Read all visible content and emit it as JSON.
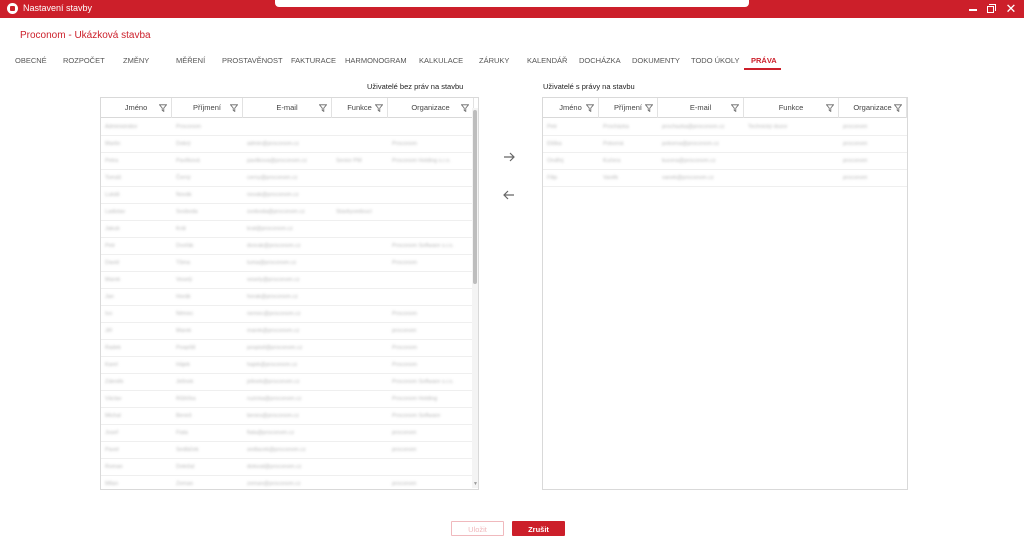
{
  "window": {
    "title": "Nastavení stavby"
  },
  "project": {
    "title": "Proconom - Ukázková stavba"
  },
  "tabs": [
    {
      "label": "OBECNÉ"
    },
    {
      "label": "ROZPOČET"
    },
    {
      "label": "ZMĚNY"
    },
    {
      "label": "MĚŘENÍ"
    },
    {
      "label": "PROSTAVĚNOST"
    },
    {
      "label": "FAKTURACE"
    },
    {
      "label": "HARMONOGRAM"
    },
    {
      "label": "KALKULACE"
    },
    {
      "label": "ZÁRUKY"
    },
    {
      "label": "KALENDÁŘ"
    },
    {
      "label": "DOCHÁZKA"
    },
    {
      "label": "DOKUMENTY"
    },
    {
      "label": "TODO ÚKOLY"
    },
    {
      "label": "PRÁVA"
    }
  ],
  "active_tab": "PRÁVA",
  "left_panel": {
    "label": "Uživatelé bez práv na stavbu",
    "columns": [
      "Jméno",
      "Příjmení",
      "E-mail",
      "Funkce",
      "Organizace"
    ],
    "rows": [
      [
        "Administrátor",
        "Proconom",
        "",
        "",
        ""
      ],
      [
        "Martin",
        "Dobrý",
        "admin@proconom.cz",
        "",
        "Proconom"
      ],
      [
        "Petra",
        "Pavlíková",
        "pavlikova@proconom.cz",
        "Senior PM",
        "Proconom Holding s.r.o."
      ],
      [
        "Tomáš",
        "Černý",
        "cerny@proconom.cz",
        "",
        ""
      ],
      [
        "Lukáš",
        "Novák",
        "novak@proconom.cz",
        "",
        ""
      ],
      [
        "Ladislav",
        "Svoboda",
        "svoboda@proconom.cz",
        "Stavbyvedoucí",
        ""
      ],
      [
        "Jakub",
        "Král",
        "kral@proconom.cz",
        "",
        ""
      ],
      [
        "Petr",
        "Dvořák",
        "dvorak@proconom.cz",
        "",
        "Proconom Software s.r.o."
      ],
      [
        "David",
        "Tůma",
        "tuma@proconom.cz",
        "",
        "Proconom"
      ],
      [
        "Marek",
        "Veselý",
        "vesely@proconom.cz",
        "",
        ""
      ],
      [
        "Jan",
        "Horák",
        "horak@proconom.cz",
        "",
        ""
      ],
      [
        "Ivo",
        "Němec",
        "nemec@proconom.cz",
        "",
        "Proconom"
      ],
      [
        "Jiří",
        "Marek",
        "marek@proconom.cz",
        "",
        "proconom"
      ],
      [
        "Radek",
        "Pospíšil",
        "pospisil@proconom.cz",
        "",
        "Proconom"
      ],
      [
        "Karel",
        "Hájek",
        "hajek@proconom.cz",
        "",
        "Proconom"
      ],
      [
        "Zdeněk",
        "Jelínek",
        "jelinek@proconom.cz",
        "",
        "Proconom Software s.r.o."
      ],
      [
        "Václav",
        "Růžička",
        "ruzicka@proconom.cz",
        "",
        "Proconom Holding"
      ],
      [
        "Michal",
        "Beneš",
        "benes@proconom.cz",
        "",
        "Proconom Software"
      ],
      [
        "Josef",
        "Fiala",
        "fiala@proconom.cz",
        "",
        "proconom"
      ],
      [
        "Pavel",
        "Sedláček",
        "sedlacek@proconom.cz",
        "",
        "proconom"
      ],
      [
        "Roman",
        "Doležal",
        "dolezal@proconom.cz",
        "",
        ""
      ],
      [
        "Milan",
        "Zeman",
        "zeman@proconom.cz",
        "",
        "proconom"
      ]
    ]
  },
  "right_panel": {
    "label": "Uživatelé s  právy na stavbu",
    "columns": [
      "Jméno",
      "Příjmení",
      "E-mail",
      "Funkce",
      "Organizace"
    ],
    "rows": [
      [
        "Petr",
        "Procházka",
        "prochazka@proconom.cz",
        "Technický dozor",
        "proconom"
      ],
      [
        "Eliška",
        "Pokorná",
        "pokorna@proconom.cz",
        "",
        "proconom"
      ],
      [
        "Ondřej",
        "Kučera",
        "kucera@proconom.cz",
        "",
        "proconom"
      ],
      [
        "Filip",
        "Vaněk",
        "vanek@proconom.cz",
        "",
        "proconom"
      ]
    ]
  },
  "transfer": {
    "to_right_icon": "arrow-right-icon",
    "to_left_icon": "arrow-left-icon"
  },
  "buttons": {
    "save": "Uložit",
    "cancel": "Zrušit"
  },
  "colors": {
    "brand": "#cc1f2a",
    "disabled_text": "#f0b9bd"
  }
}
